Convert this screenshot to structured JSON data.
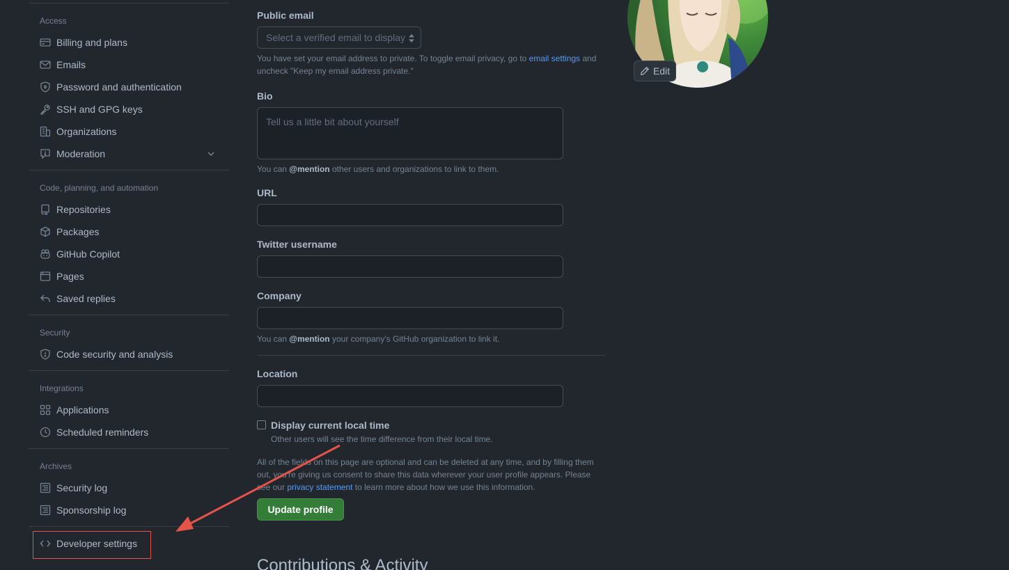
{
  "sidebar": {
    "sections": {
      "access": "Access",
      "code": "Code, planning, and automation",
      "security": "Security",
      "integrations": "Integrations",
      "archives": "Archives"
    },
    "items": {
      "billing": "Billing and plans",
      "emails": "Emails",
      "password": "Password and authentication",
      "ssh": "SSH and GPG keys",
      "organizations": "Organizations",
      "moderation": "Moderation",
      "repositories": "Repositories",
      "packages": "Packages",
      "copilot": "GitHub Copilot",
      "pages": "Pages",
      "saved_replies": "Saved replies",
      "code_security": "Code security and analysis",
      "applications": "Applications",
      "scheduled_reminders": "Scheduled reminders",
      "security_log": "Security log",
      "sponsorship_log": "Sponsorship log",
      "developer_settings": "Developer settings"
    }
  },
  "form": {
    "public_email": {
      "label": "Public email",
      "placeholder": "Select a verified email to display",
      "note_pre": "You have set your email address to private. To toggle email privacy, go to ",
      "note_link": "email settings",
      "note_post": " and uncheck \"Keep my email address private.\""
    },
    "bio": {
      "label": "Bio",
      "placeholder": "Tell us a little bit about yourself",
      "note_pre": "You can ",
      "note_mention": "@mention",
      "note_post": " other users and organizations to link to them."
    },
    "url": {
      "label": "URL",
      "value": ""
    },
    "twitter": {
      "label": "Twitter username",
      "value": ""
    },
    "company": {
      "label": "Company",
      "value": "",
      "note_pre": "You can ",
      "note_mention": "@mention",
      "note_post": " your company's GitHub organization to link it."
    },
    "location": {
      "label": "Location",
      "value": ""
    },
    "local_time": {
      "label": "Display current local time",
      "checked": false,
      "note": "Other users will see the time difference from their local time."
    },
    "disclaimer": {
      "pre": "All of the fields on this page are optional and can be deleted at any time, and by filling them out, you're giving us consent to share this data wherever your user profile appears. Please see our ",
      "link": "privacy statement",
      "post": " to learn more about how we use this information."
    },
    "submit_label": "Update profile",
    "next_section_title": "Contributions & Activity"
  },
  "avatar": {
    "edit_label": "Edit"
  },
  "colors": {
    "background": "#22272e",
    "link": "#539bf5",
    "primary_button": "#347d39",
    "annotation": "#e5534b"
  },
  "icons": {
    "billing": "credit-card-icon",
    "emails": "mail-icon",
    "password": "shield-lock-icon",
    "ssh": "key-icon",
    "organizations": "organization-icon",
    "moderation": "report-icon",
    "repositories": "repo-icon",
    "packages": "package-icon",
    "copilot": "copilot-icon",
    "pages": "browser-icon",
    "saved_replies": "reply-icon",
    "code_security": "shield-icon",
    "applications": "apps-icon",
    "scheduled_reminders": "clock-icon",
    "security_log": "log-icon",
    "sponsorship_log": "log-icon",
    "developer_settings": "code-icon",
    "edit": "pencil-icon"
  }
}
